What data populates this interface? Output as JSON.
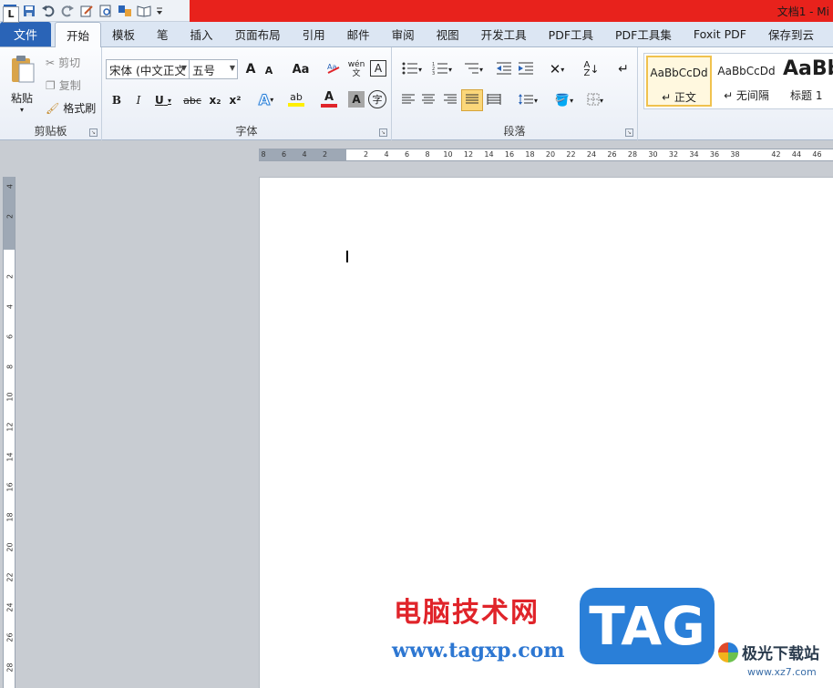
{
  "titlebar": {
    "title": "文档1 - Mi"
  },
  "tabs": [
    {
      "label": "文件"
    },
    {
      "label": "开始"
    },
    {
      "label": "模板"
    },
    {
      "label": "笔"
    },
    {
      "label": "插入"
    },
    {
      "label": "页面布局"
    },
    {
      "label": "引用"
    },
    {
      "label": "邮件"
    },
    {
      "label": "审阅"
    },
    {
      "label": "视图"
    },
    {
      "label": "开发工具"
    },
    {
      "label": "PDF工具"
    },
    {
      "label": "PDF工具集"
    },
    {
      "label": "Foxit PDF"
    },
    {
      "label": "保存到云"
    }
  ],
  "clipboard": {
    "paste": "粘贴",
    "cut": "剪切",
    "copy": "复制",
    "format_painter": "格式刷",
    "group_label": "剪贴板"
  },
  "font": {
    "font_name": "宋体 (中文正文",
    "font_size": "五号",
    "group_label": "字体",
    "grow": "A",
    "shrink": "A",
    "case": "Aa",
    "bold": "B",
    "italic": "I",
    "underline": "U",
    "strike": "abc",
    "sub": "x₂",
    "sup": "x²",
    "phonetic": "wén 文",
    "border_char": "A",
    "enclose": "字"
  },
  "paragraph": {
    "group_label": "段落"
  },
  "styles": {
    "items": [
      {
        "sample": "AaBbCcDd",
        "name": "↵ 正文"
      },
      {
        "sample": "AaBbCcDd",
        "name": "↵ 无间隔"
      },
      {
        "sample": "AaBb",
        "name": "标题 1"
      }
    ]
  },
  "ruler": {
    "corner": "L",
    "h_ticks": [
      "8",
      "6",
      "4",
      "2",
      "2",
      "4",
      "6",
      "8",
      "10",
      "12",
      "14",
      "16",
      "18",
      "20",
      "22",
      "24",
      "26",
      "28",
      "30",
      "32",
      "34",
      "36",
      "38",
      "42",
      "44",
      "46"
    ],
    "v_ticks": [
      "4",
      "2",
      "2",
      "4",
      "6",
      "8",
      "10",
      "12",
      "14",
      "16",
      "18",
      "20",
      "22",
      "24",
      "26",
      "28"
    ]
  },
  "watermark": {
    "cn_text": "电脑技术网",
    "url": "www.tagxp.com",
    "tag": "TAG",
    "xz_name": "极光下载站",
    "xz_url": "www.xz7.com"
  },
  "colors": {
    "title_red": "#e8221c",
    "file_tab_blue": "#2a64b7",
    "watermark_red": "#e0242a",
    "watermark_blue": "#2a7fd8"
  }
}
